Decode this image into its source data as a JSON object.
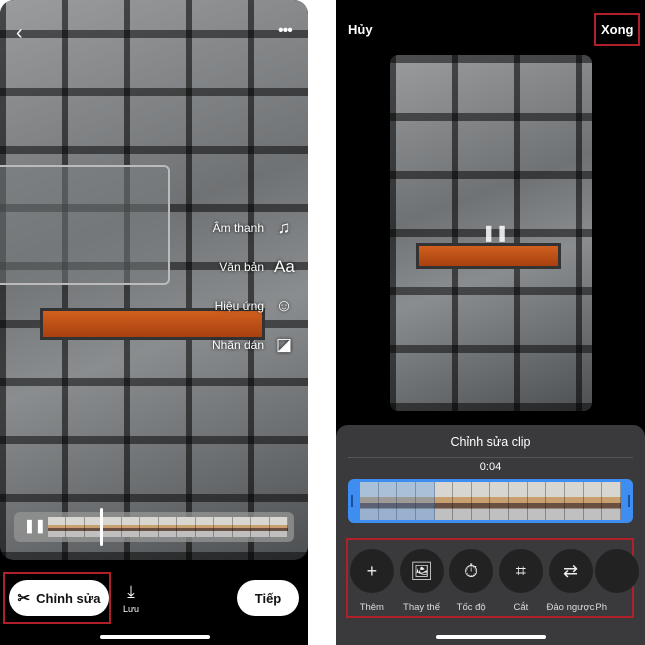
{
  "left": {
    "side_menu": [
      {
        "label": "Âm thanh",
        "icon": "music-note-icon"
      },
      {
        "label": "Văn bản",
        "icon": "text-icon"
      },
      {
        "label": "Hiệu ứng",
        "icon": "effects-icon"
      },
      {
        "label": "Nhãn dán",
        "icon": "sticker-icon"
      }
    ],
    "edit_label": "Chỉnh sửa",
    "save_label": "Lưu",
    "next_label": "Tiếp"
  },
  "right": {
    "cancel_label": "Hủy",
    "done_label": "Xong",
    "sheet_title": "Chỉnh sửa clip",
    "clip_duration": "0:04",
    "tools": [
      {
        "label": "Thêm",
        "icon": "plus-icon"
      },
      {
        "label": "Thay thế",
        "icon": "replace-image-icon"
      },
      {
        "label": "Tốc độ",
        "icon": "stopwatch-icon"
      },
      {
        "label": "Cắt",
        "icon": "crop-icon"
      },
      {
        "label": "Đảo ngược",
        "icon": "reverse-icon"
      },
      {
        "label": "Ph",
        "icon": "more-tool-icon"
      }
    ]
  },
  "colors": {
    "trim_handle": "#3d8ef0",
    "highlight": "#b0202a",
    "sheet": "#3a3a3c"
  }
}
